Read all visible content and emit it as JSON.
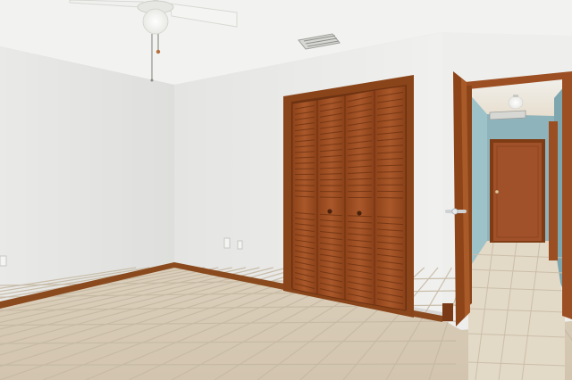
{
  "scene": {
    "kind": "photograph",
    "subject": "empty-bedroom",
    "objects": [
      "ceiling-fan-with-light",
      "hvac-vent",
      "closet-bifold-louvered-doors",
      "open-interior-door",
      "hallway",
      "hallway-door",
      "hallway-ceiling-light",
      "tile-floor",
      "baseboard",
      "wall-outlets"
    ]
  },
  "colors": {
    "wall_left": "#e6e6e4",
    "wall_center": "#ebebe9",
    "ceiling": "#f1f1ef",
    "floor": "#d8cbb6",
    "floor_grout": "#c4b7a3",
    "wood": "#9c4f22",
    "wood_dark": "#7a3a17",
    "wood_light": "#b8652e",
    "hall_wall": "#8fb3bb",
    "hall_floor": "#e2d8c6",
    "trim": "#8a4a1e"
  }
}
